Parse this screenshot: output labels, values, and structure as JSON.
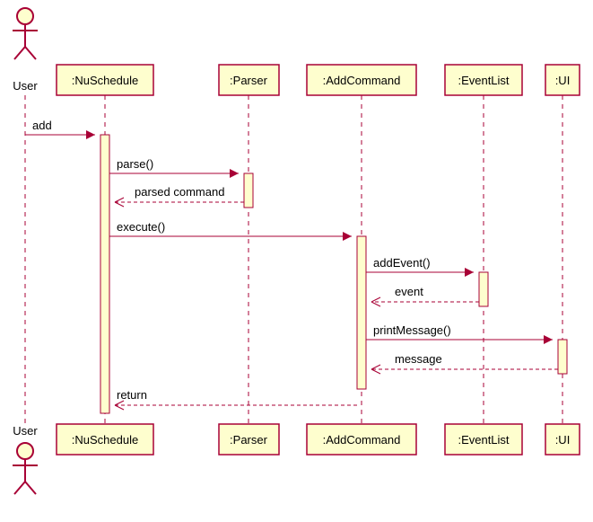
{
  "actor": {
    "top_label": "User",
    "bottom_label": "User"
  },
  "participants": {
    "nuschedule": ":NuSchedule",
    "parser": ":Parser",
    "addcommand": ":AddCommand",
    "eventlist": ":EventList",
    "ui": ":UI"
  },
  "messages": {
    "m1": "add",
    "m2": "parse()",
    "m3": "parsed command",
    "m4": "execute()",
    "m5": "addEvent()",
    "m6": "event",
    "m7": "printMessage()",
    "m8": "message",
    "m9": "return"
  },
  "colors": {
    "line": "#A80036",
    "fill": "#FEFECE"
  }
}
